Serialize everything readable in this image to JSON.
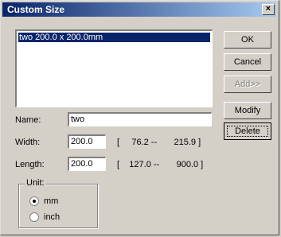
{
  "window": {
    "title": "Custom Size",
    "close_label": "×"
  },
  "list": {
    "items": [
      "two 200.0 x 200.0mm"
    ]
  },
  "buttons": {
    "ok": "OK",
    "cancel": "Cancel",
    "add": "Add>>",
    "modify": "Modify",
    "delete": "Delete"
  },
  "fields": {
    "name_label": "Name:",
    "name_value": "two",
    "width_label": "Width:",
    "width_value": "200.0",
    "width_range": "[     76.2 --       215.9 ]",
    "length_label": "Length:",
    "length_value": "200.0",
    "length_range": "[    127.0 --       900.0 ]"
  },
  "unit": {
    "group_label": "Unit:",
    "options": [
      {
        "label": "mm",
        "selected": true
      },
      {
        "label": "inch",
        "selected": false
      }
    ]
  }
}
